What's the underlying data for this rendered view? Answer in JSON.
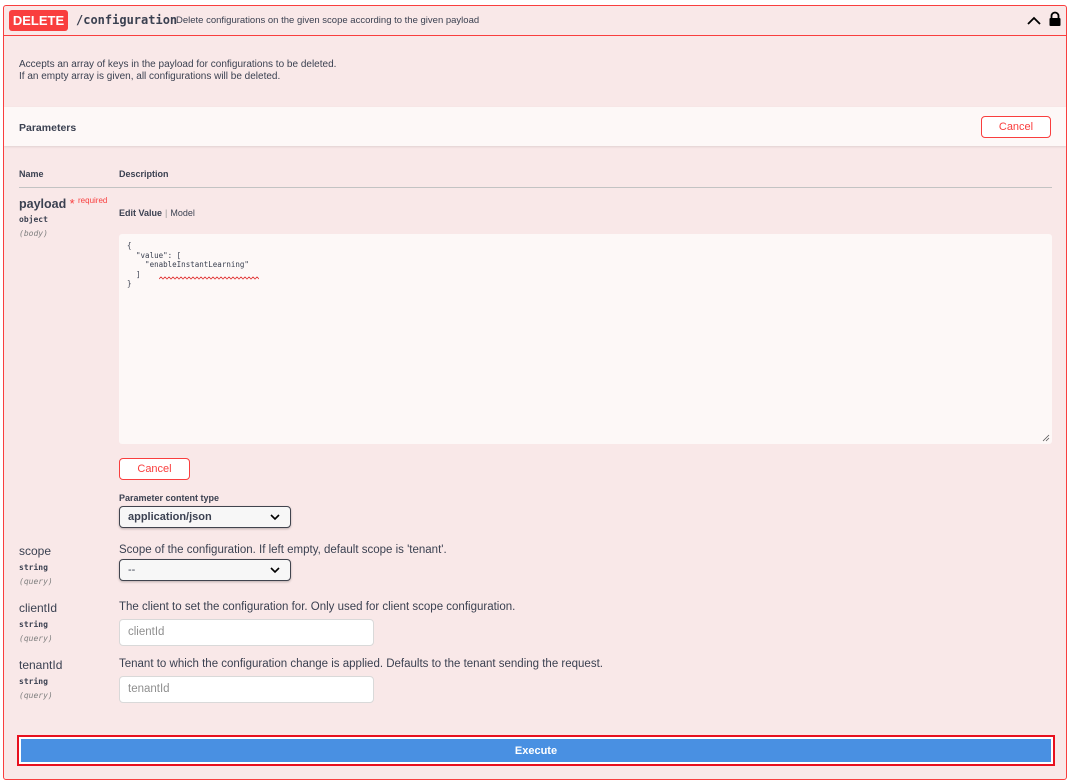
{
  "operation": {
    "method": "DELETE",
    "path": "/configuration",
    "summary": "Delete configurations on the given scope according to the given payload",
    "method_color": "#f93e3e"
  },
  "description": {
    "line1": "Accepts an array of keys in the payload for configurations to be deleted.",
    "line2": "If an empty array is given, all configurations will be deleted."
  },
  "parameters": {
    "title": "Parameters",
    "cancel_label": "Cancel",
    "col_name": "Name",
    "col_description": "Description"
  },
  "payload": {
    "name": "payload",
    "required_star": "*",
    "required_label": "required",
    "type": "object",
    "in": "(body)",
    "tab_edit": "Edit Value",
    "tab_sep": "|",
    "tab_model": "Model",
    "editor_value": "{\n  \"value\": [\n    \"enableInstantLearning\"\n  ]\n}",
    "cancel_label": "Cancel",
    "content_type_label": "Parameter content type",
    "content_type_value": "application/json"
  },
  "scope": {
    "name": "scope",
    "type": "string",
    "in": "(query)",
    "description": "Scope of the configuration. If left empty, default scope is 'tenant'.",
    "selected": "--"
  },
  "clientId": {
    "name": "clientId",
    "type": "string",
    "in": "(query)",
    "description": "The client to set the configuration for. Only used for client scope configuration.",
    "placeholder": "clientId"
  },
  "tenantId": {
    "name": "tenantId",
    "type": "string",
    "in": "(query)",
    "description": "Tenant to which the configuration change is applied. Defaults to the tenant sending the request.",
    "placeholder": "tenantId"
  },
  "execute": {
    "label": "Execute",
    "color": "#4990e2"
  },
  "icons": {
    "collapse": "chevron-up-icon",
    "lock": "lock-icon",
    "dropdown": "chevron-down-icon"
  }
}
